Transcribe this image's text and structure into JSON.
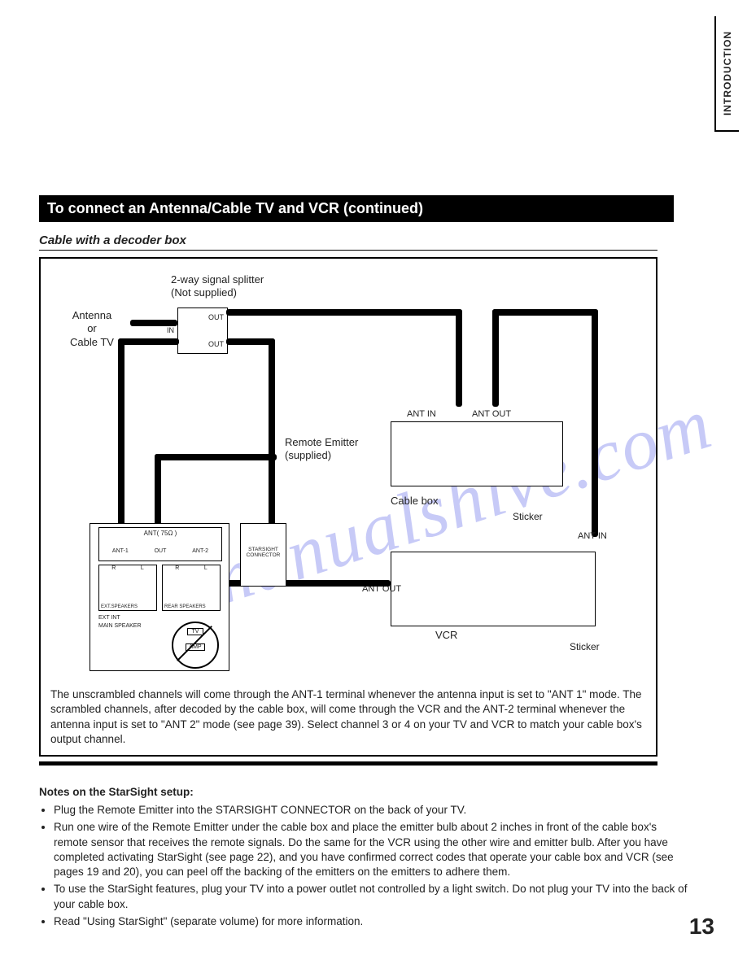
{
  "sideTab": "INTRODUCTION",
  "title": "To connect an Antenna/Cable TV and VCR (continued)",
  "subtitle": "Cable with a decoder box",
  "watermark": "manualshive.com",
  "diagram": {
    "splitter_title": "2-way signal splitter\n(Not supplied)",
    "source": "Antenna\nor\nCable TV",
    "splitter_in": "IN",
    "splitter_out": "OUT",
    "remote_emitter": "Remote Emitter\n(supplied)",
    "ant_in": "ANT IN",
    "ant_out": "ANT OUT",
    "cable_box": "Cable box",
    "vcr": "VCR",
    "sticker": "Sticker",
    "tv_ant_header": "ANT( 75Ω )",
    "tv_ant1": "ANT-1",
    "tv_out": "OUT",
    "tv_ant2": "ANT-2",
    "starsight_conn": "STARSIGHT\nCONNECTOR",
    "spk_r": "R",
    "spk_l": "L",
    "ext_speakers": "EXT.SPEAKERS",
    "rear_speakers": "REAR SPEAKERS",
    "ext_int": "EXT   INT",
    "main_speaker": "MAIN SPEAKER",
    "tv_icon": "TV",
    "amp_icon": "AMP"
  },
  "bodyText": "The unscrambled channels will come through the ANT-1 terminal whenever the antenna input is set to \"ANT 1\" mode. The scrambled channels, after decoded by the cable box, will come through the VCR and the ANT-2 terminal whenever the antenna input is set to \"ANT 2\" mode (see page 39). Select channel 3 or 4 on your TV and VCR to match your cable box's output channel.",
  "notesTitle": "Notes on the StarSight setup:",
  "notes": [
    "Plug the Remote Emitter into the STARSIGHT CONNECTOR on the back of your TV.",
    "Run one wire of the Remote Emitter under the cable box and place the emitter bulb about 2 inches in front of the cable box's remote sensor that receives the remote signals. Do the same for the VCR using the other wire and emitter bulb. After you have completed activating StarSight (see page 22), and you have confirmed correct codes that operate your cable box and VCR (see pages 19 and 20), you can peel off the backing of the emitters on the emitters to adhere them.",
    "To use the StarSight features, plug your TV into a power outlet not controlled by a light switch. Do not plug your TV into the back of your cable box.",
    "Read \"Using StarSight\" (separate volume) for more information."
  ],
  "pageNumber": "13"
}
